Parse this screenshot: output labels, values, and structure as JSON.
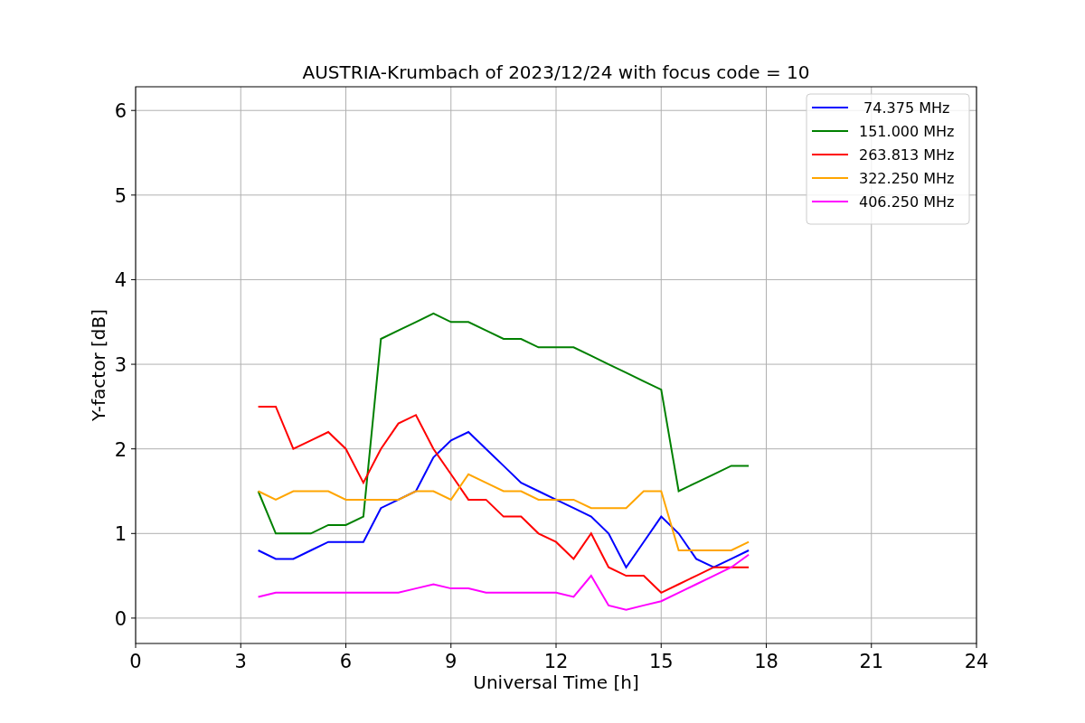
{
  "chart_data": {
    "type": "line",
    "title": "AUSTRIA-Krumbach of 2023/12/24 with focus code = 10",
    "xlabel": "Universal Time [h]",
    "ylabel": "Y-factor [dB]",
    "x": [
      3.5,
      4,
      4.5,
      5,
      5.5,
      6,
      6.5,
      7,
      7.5,
      8,
      8.5,
      9,
      9.5,
      10,
      10.5,
      11,
      11.5,
      12,
      12.5,
      13,
      13.5,
      14,
      14.5,
      15,
      15.5,
      16,
      16.5,
      17,
      17.5
    ],
    "series": [
      {
        "name": " 74.375 MHz",
        "color": "#0000ff",
        "values": [
          0.8,
          0.7,
          0.7,
          0.8,
          0.9,
          0.9,
          0.9,
          1.3,
          1.4,
          1.5,
          1.9,
          2.1,
          2.2,
          2.0,
          1.8,
          1.6,
          1.5,
          1.4,
          1.3,
          1.2,
          1.0,
          0.6,
          0.9,
          1.2,
          1.0,
          0.7,
          0.6,
          0.7,
          0.8
        ]
      },
      {
        "name": "151.000 MHz",
        "color": "#008000",
        "values": [
          1.5,
          1.0,
          1.0,
          1.0,
          1.1,
          1.1,
          1.2,
          3.3,
          3.4,
          3.5,
          3.6,
          3.5,
          3.5,
          3.4,
          3.3,
          3.3,
          3.2,
          3.2,
          3.2,
          3.1,
          3.0,
          2.9,
          2.8,
          2.7,
          1.5,
          1.6,
          1.7,
          1.8,
          1.8
        ]
      },
      {
        "name": "263.813 MHz",
        "color": "#ff0000",
        "values": [
          2.5,
          2.5,
          2.0,
          2.1,
          2.2,
          2.0,
          1.6,
          2.0,
          2.3,
          2.4,
          2.0,
          1.7,
          1.4,
          1.4,
          1.2,
          1.2,
          1.0,
          0.9,
          0.7,
          1.0,
          0.6,
          0.5,
          0.5,
          0.3,
          0.4,
          0.5,
          0.6,
          0.6,
          0.6
        ]
      },
      {
        "name": "322.250 MHz",
        "color": "#ffa500",
        "values": [
          1.5,
          1.4,
          1.5,
          1.5,
          1.5,
          1.4,
          1.4,
          1.4,
          1.4,
          1.5,
          1.5,
          1.4,
          1.7,
          1.6,
          1.5,
          1.5,
          1.4,
          1.4,
          1.4,
          1.3,
          1.3,
          1.3,
          1.5,
          1.5,
          0.8,
          0.8,
          0.8,
          0.8,
          0.9
        ]
      },
      {
        "name": "406.250 MHz",
        "color": "#ff00ff",
        "values": [
          0.25,
          0.3,
          0.3,
          0.3,
          0.3,
          0.3,
          0.3,
          0.3,
          0.3,
          0.35,
          0.4,
          0.35,
          0.35,
          0.3,
          0.3,
          0.3,
          0.3,
          0.3,
          0.25,
          0.5,
          0.15,
          0.1,
          0.15,
          0.2,
          0.3,
          0.4,
          0.5,
          0.6,
          0.75
        ]
      }
    ],
    "grid": true,
    "legend": true,
    "xlim": [
      0,
      24
    ],
    "ylim": [
      -0.3,
      6.28
    ],
    "xticks": [
      0,
      3,
      6,
      9,
      12,
      15,
      18,
      21,
      24
    ],
    "yticks": [
      0,
      1,
      2,
      3,
      4,
      5,
      6
    ]
  }
}
